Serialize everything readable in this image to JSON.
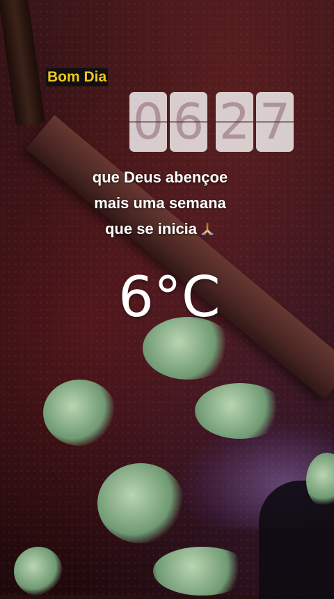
{
  "story": {
    "greeting": "Bom Dia",
    "clock": {
      "hour": [
        "0",
        "6"
      ],
      "minute": [
        "2",
        "7"
      ]
    },
    "message_lines": [
      "que Deus abençoe",
      "mais uma semana",
      "que se inicia"
    ],
    "message_emoji_icon": "praying-hands-icon",
    "temperature": "6°C"
  },
  "colors": {
    "greeting_text": "#f3c61c",
    "greeting_bg": "#101010",
    "clock_tile": "#ffffff"
  }
}
